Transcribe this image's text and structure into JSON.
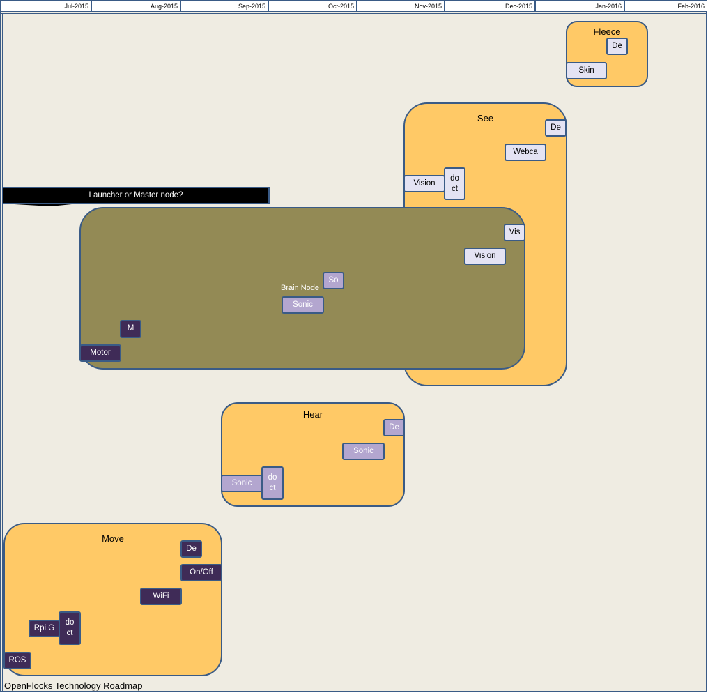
{
  "timeline": {
    "months": [
      "Jul-2015",
      "Aug-2015",
      "Sep-2015",
      "Oct-2015",
      "Nov-2015",
      "Dec-2015",
      "Jan-2016",
      "Feb-2016"
    ]
  },
  "launcher": {
    "label": "Launcher or Master node?"
  },
  "brain": {
    "title": "Brain Node",
    "items": [
      "So",
      "Sonic",
      "M",
      "Motor",
      "Vis",
      "Vision"
    ]
  },
  "fleece": {
    "title": "Fleece",
    "items": [
      "De",
      "Skin"
    ]
  },
  "see": {
    "title": "See",
    "items": [
      "De",
      "Webca",
      "Vision",
      "do",
      "ct"
    ]
  },
  "hear": {
    "title": "Hear",
    "items": [
      "De",
      "Sonic",
      "Sonic",
      "do",
      "ct"
    ]
  },
  "move": {
    "title": "Move",
    "items": [
      "De",
      "On/Off",
      "WiFi",
      "Rpi.G",
      "do",
      "ct",
      "ROS"
    ]
  },
  "footer": "OpenFlocks Technology Roadmap",
  "colors": {
    "box": "#ffc966",
    "brain": "#938a55",
    "border": "#3a5b86",
    "background": "#efece2"
  }
}
